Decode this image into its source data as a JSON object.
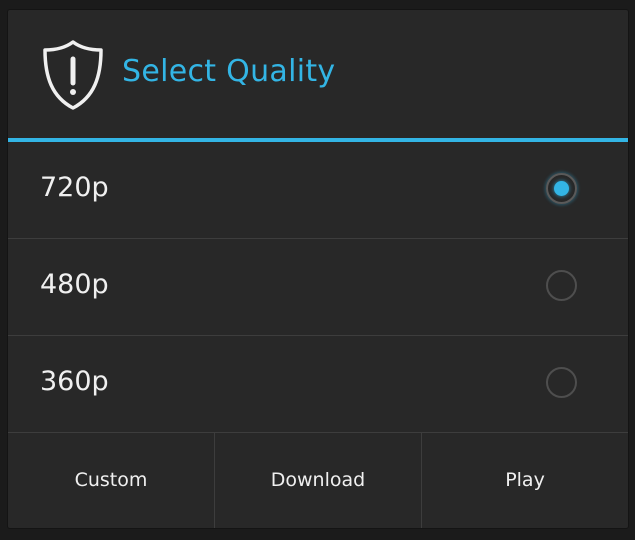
{
  "dialog": {
    "title": "Select Quality",
    "icon": "shield-exclamation-icon",
    "accent_color": "#33b5e5"
  },
  "options": [
    {
      "label": "720p",
      "selected": true
    },
    {
      "label": "480p",
      "selected": false
    },
    {
      "label": "360p",
      "selected": false
    }
  ],
  "buttons": {
    "custom": "Custom",
    "download": "Download",
    "play": "Play"
  }
}
